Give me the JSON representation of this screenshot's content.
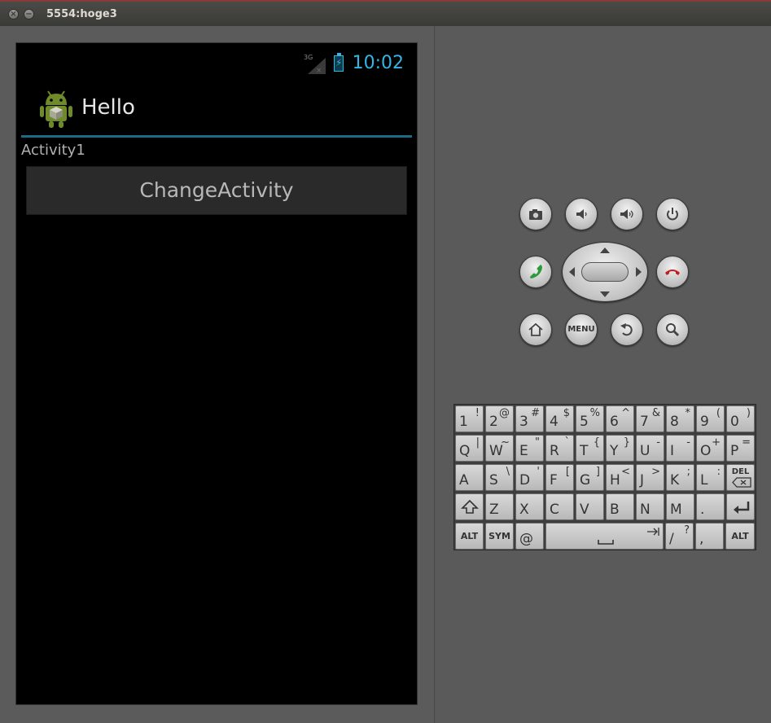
{
  "window": {
    "title": "5554:hoge3"
  },
  "status_bar": {
    "network": "3G",
    "time": "10:02"
  },
  "app": {
    "title": "Hello",
    "label": "Activity1",
    "button": "ChangeActivity"
  },
  "hardware_buttons": {
    "camera": "camera-icon",
    "volume_down": "volume-down-icon",
    "volume_up": "volume-up-icon",
    "power": "power-icon",
    "call": "call-icon",
    "end_call": "end-call-icon",
    "home": "home-icon",
    "menu": "MENU",
    "back": "back-icon",
    "search": "search-icon"
  },
  "keyboard": {
    "row1": [
      {
        "m": "1",
        "s": "!"
      },
      {
        "m": "2",
        "s": "@"
      },
      {
        "m": "3",
        "s": "#"
      },
      {
        "m": "4",
        "s": "$"
      },
      {
        "m": "5",
        "s": "%"
      },
      {
        "m": "6",
        "s": "^"
      },
      {
        "m": "7",
        "s": "&"
      },
      {
        "m": "8",
        "s": "*"
      },
      {
        "m": "9",
        "s": "("
      },
      {
        "m": "0",
        "s": ")"
      }
    ],
    "row2": [
      {
        "m": "Q",
        "s": "|"
      },
      {
        "m": "W",
        "s": "~"
      },
      {
        "m": "E",
        "s": "\""
      },
      {
        "m": "R",
        "s": "`"
      },
      {
        "m": "T",
        "s": "{"
      },
      {
        "m": "Y",
        "s": "}"
      },
      {
        "m": "U",
        "s": "-"
      },
      {
        "m": "I",
        "s": "-"
      },
      {
        "m": "O",
        "s": "+"
      },
      {
        "m": "P",
        "s": "="
      }
    ],
    "row3": [
      {
        "m": "A",
        "s": ""
      },
      {
        "m": "S",
        "s": "\\"
      },
      {
        "m": "D",
        "s": "'"
      },
      {
        "m": "F",
        "s": "["
      },
      {
        "m": "G",
        "s": "]"
      },
      {
        "m": "H",
        "s": "<"
      },
      {
        "m": "J",
        "s": ">"
      },
      {
        "m": "K",
        "s": ";"
      },
      {
        "m": "L",
        "s": ":"
      },
      {
        "m": "DEL",
        "s": ""
      }
    ],
    "row4": [
      {
        "m": "shift",
        "s": ""
      },
      {
        "m": "Z",
        "s": ""
      },
      {
        "m": "X",
        "s": ""
      },
      {
        "m": "C",
        "s": ""
      },
      {
        "m": "V",
        "s": ""
      },
      {
        "m": "B",
        "s": ""
      },
      {
        "m": "N",
        "s": ""
      },
      {
        "m": "M",
        "s": ""
      },
      {
        "m": ".",
        "s": ""
      },
      {
        "m": "enter",
        "s": ""
      }
    ],
    "alt": "ALT",
    "sym": "SYM",
    "at": "@",
    "slash": "/",
    "question": "?",
    "comma": ","
  },
  "colors": {
    "accent": "#33b5e5",
    "call_green": "#2a9a3a",
    "end_red": "#c21e1e"
  }
}
